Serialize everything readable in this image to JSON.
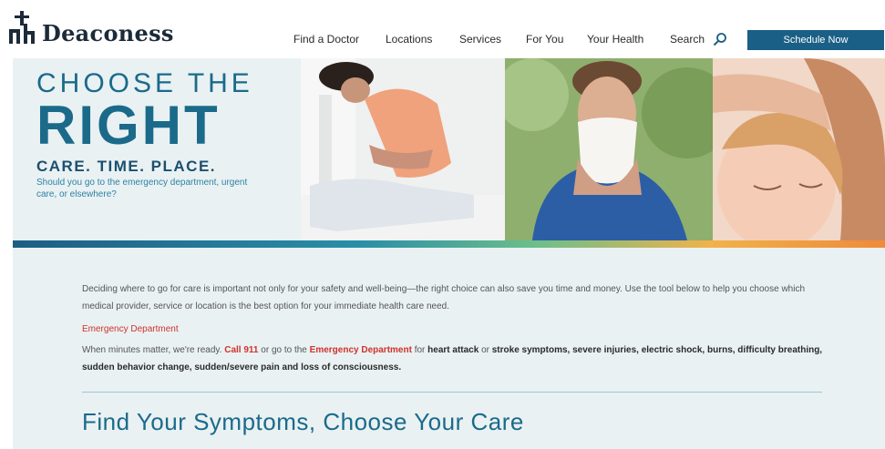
{
  "brand": {
    "name": "Deaconess"
  },
  "nav": {
    "items": [
      "Find a Doctor",
      "Locations",
      "Services",
      "For You",
      "Your Health",
      "Search"
    ],
    "schedule_label": "Schedule Now"
  },
  "hero": {
    "line1": "CHOOSE THE",
    "line2": "RIGHT",
    "line3": "CARE. TIME. PLACE.",
    "line4": "Should you go to the emergency department, urgent care, or elsewhere?"
  },
  "content": {
    "intro": "Deciding where to go for care is important not only for your safety and well-being—the right choice can also save you time and money. Use the tool below to help you choose which medical provider, service or location is the best option for your immediate health care need.",
    "ed_title": "Emergency Department",
    "ed_p1": "When minutes matter, we're ready. ",
    "ed_call": "Call 911",
    "ed_p2": " or go to the ",
    "ed_dept": "Emergency Department",
    "ed_p3": " for ",
    "ed_heart": "heart attack",
    "ed_p4": " or ",
    "ed_rest": "stroke symptoms, severe injuries, electric shock, burns, difficulty breathing, sudden behavior change, sudden/severe pain and loss of consciousness.",
    "find_title": "Find Your Symptoms, Choose Your Care"
  },
  "colors": {
    "brand_blue": "#1a5f86",
    "hero_blue": "#1b6a8a",
    "alert_red": "#d0322b"
  }
}
